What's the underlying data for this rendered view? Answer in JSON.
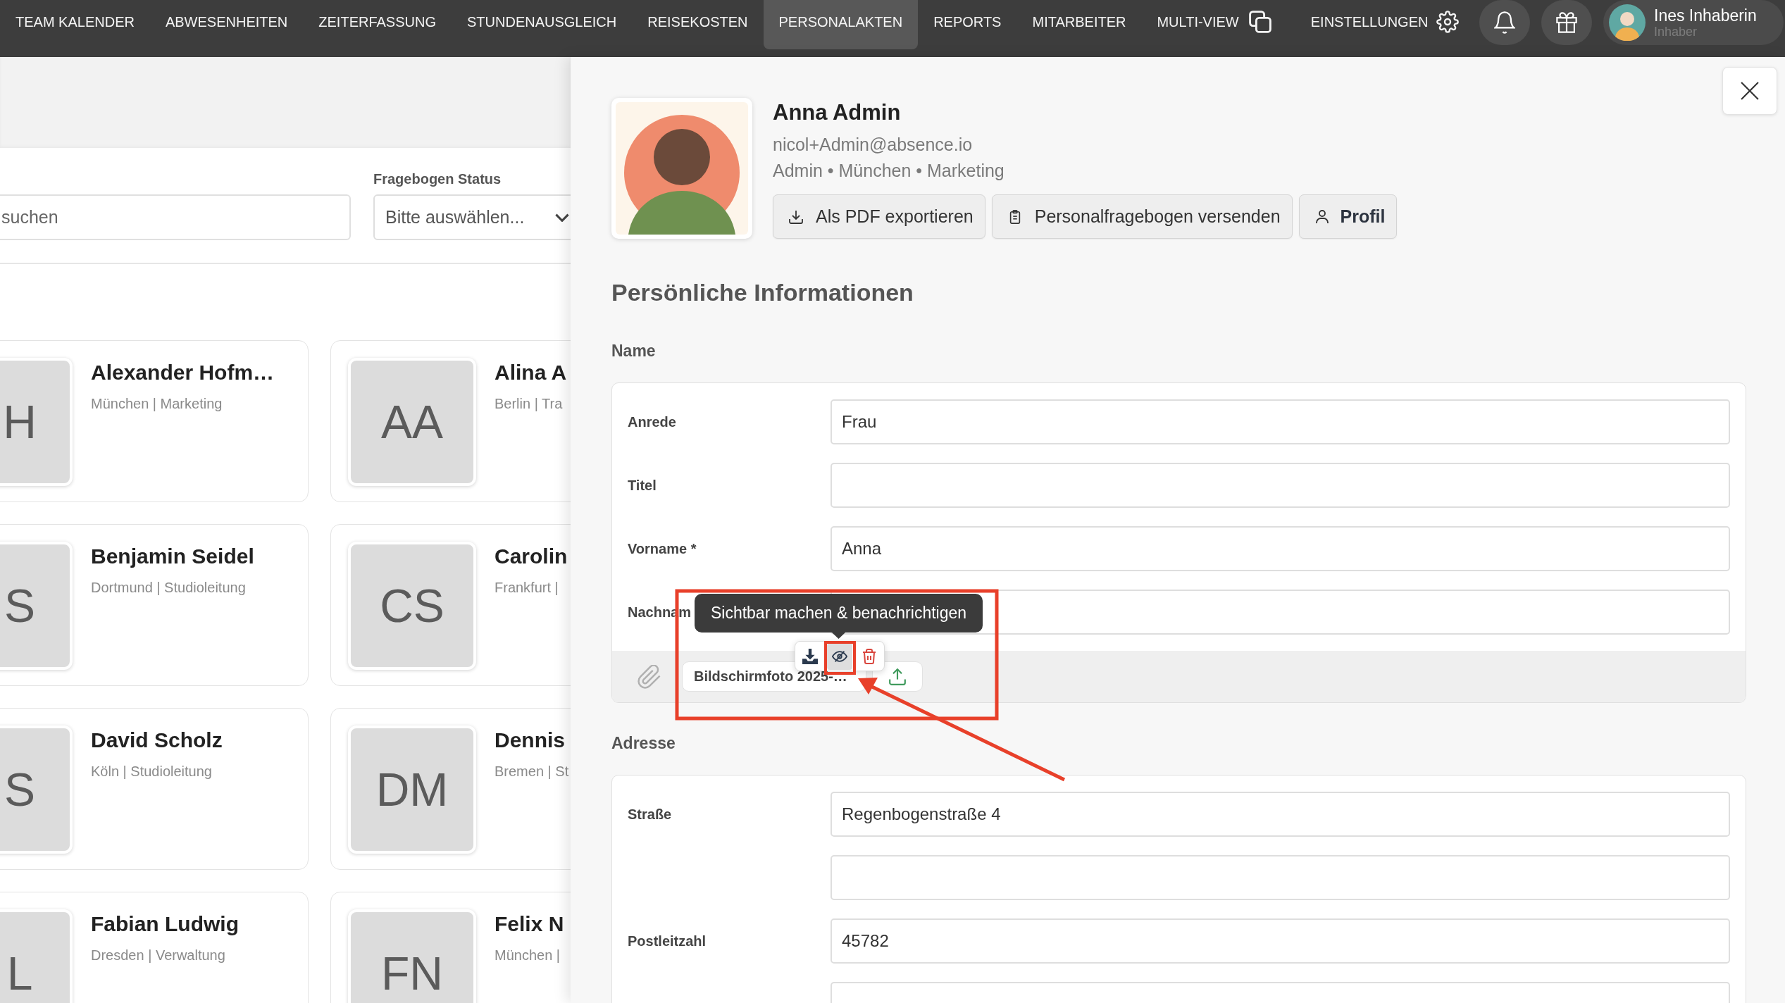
{
  "top_nav": {
    "items": [
      {
        "label": "TEAM KALENDER",
        "kind": "text",
        "selected": false
      },
      {
        "label": "ABWESENHEITEN",
        "kind": "text",
        "selected": false
      },
      {
        "label": "ZEITERFASSUNG",
        "kind": "text",
        "selected": false
      },
      {
        "label": "STUNDENAUSGLEICH",
        "kind": "text",
        "selected": false
      },
      {
        "label": "REISEKOSTEN",
        "kind": "text",
        "selected": false
      },
      {
        "label": "PERSONALAKTEN",
        "kind": "text",
        "selected": true
      },
      {
        "label": "REPORTS",
        "kind": "text",
        "selected": false
      },
      {
        "label": "MITARBEITER",
        "kind": "text",
        "selected": false
      },
      {
        "label": "MULTI-VIEW",
        "kind": "multiview",
        "selected": false
      },
      {
        "label": "EINSTELLUNGEN",
        "kind": "settings",
        "selected": false
      }
    ],
    "user": {
      "name": "Ines Inhaberin",
      "role": "Inhaber"
    }
  },
  "filters": {
    "search": {
      "placeholder": "suchen"
    },
    "status": {
      "label": "Fragebogen Status",
      "placeholder": "Bitte auswählen..."
    }
  },
  "employees": [
    {
      "initials": "H",
      "name": "Alexander Hofm…",
      "details": "München | Marketing"
    },
    {
      "initials": "AA",
      "name": "Alina A",
      "details": "Berlin | Tra"
    },
    {
      "initials": "S",
      "name": "Benjamin Seidel",
      "details": "Dortmund | Studioleitung"
    },
    {
      "initials": "CS",
      "name": "Carolin",
      "details": "Frankfurt |"
    },
    {
      "initials": "S",
      "name": "David Scholz",
      "details": "Köln | Studioleitung"
    },
    {
      "initials": "DM",
      "name": "Dennis",
      "details": "Bremen | St"
    },
    {
      "initials": "L",
      "name": "Fabian Ludwig",
      "details": "Dresden | Verwaltung"
    },
    {
      "initials": "FN",
      "name": "Felix N",
      "details": "München |"
    }
  ],
  "profile": {
    "name": "Anna Admin",
    "email": "nicol+Admin@absence.io",
    "meta": "Admin • München • Marketing",
    "actions": [
      {
        "label": "Als PDF exportieren",
        "kind": "export"
      },
      {
        "label": "Personalfragebogen versenden",
        "kind": "send"
      },
      {
        "label": "Profil",
        "kind": "profile"
      }
    ]
  },
  "personal_info": {
    "title": "Persönliche Informationen",
    "groups": [
      {
        "title": "Name",
        "fields": [
          {
            "kind": "text_input",
            "label": "Anrede",
            "value": "Frau"
          },
          {
            "kind": "text_input",
            "label": "Titel"
          },
          {
            "kind": "text_input",
            "label": "Vorname *",
            "value": "Anna"
          },
          {
            "kind": "text_input",
            "label": "Nachnam"
          }
        ],
        "attachment": {
          "file_name": "Bildschirmfoto 2025-…",
          "tooltip": "Sichtbar machen & benachrichtigen",
          "actions": [
            {
              "kind": "download",
              "selected": false
            },
            {
              "kind": "visibility",
              "selected": true
            },
            {
              "kind": "delete",
              "selected": false
            }
          ]
        }
      },
      {
        "title": "Adresse",
        "fields": [
          {
            "kind": "text_input",
            "label": "Straße",
            "value": "Regenbogenstraße 4"
          },
          {
            "kind": "text_input"
          },
          {
            "kind": "text_input",
            "label": "Postleitzahl",
            "value": "45782"
          },
          {
            "kind": "text_input"
          }
        ]
      }
    ]
  }
}
